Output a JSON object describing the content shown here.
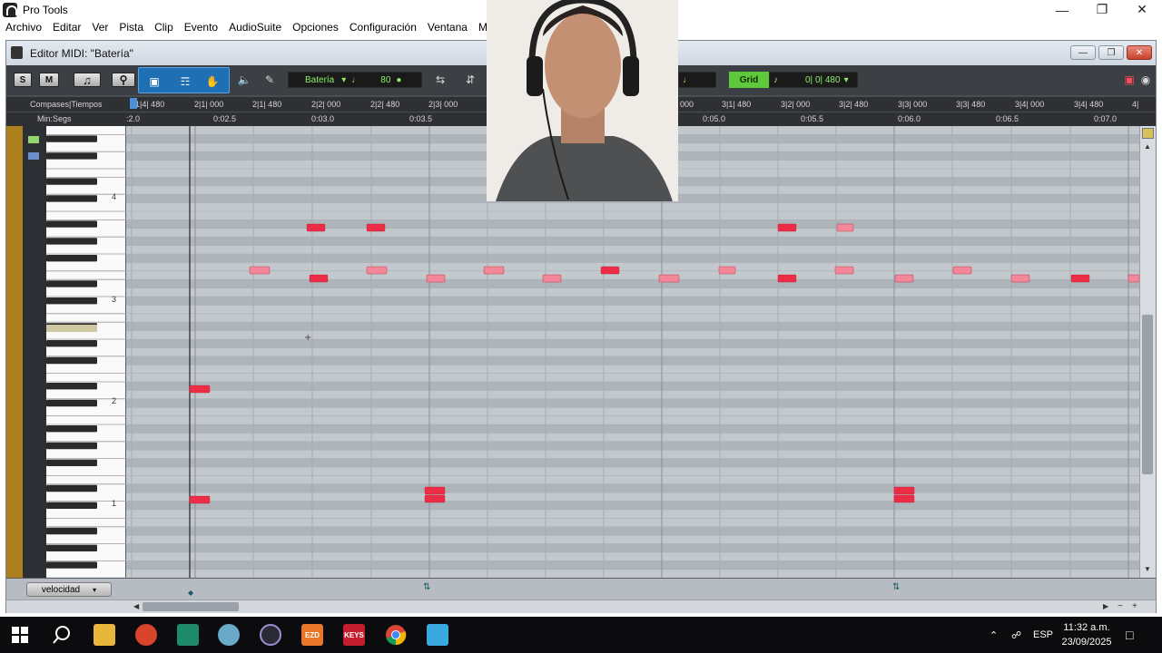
{
  "app": {
    "title": "Pro Tools"
  },
  "menubar": {
    "items": [
      "Archivo",
      "Editar",
      "Ver",
      "Pista",
      "Clip",
      "Evento",
      "AudioSuite",
      "Opciones",
      "Configuración",
      "Ventana",
      "Marke"
    ]
  },
  "editor": {
    "title": "Editor MIDI: \"Batería\"",
    "solo_label": "S",
    "mute_label": "M",
    "track_name": "Batería",
    "tempo_value": "80",
    "grid_label": "Grid",
    "grid_value": "0| 0| 480"
  },
  "ruler": {
    "header_bars": "Compases|Tiempos",
    "header_time": "Min:Segs",
    "bar_labels": [
      "1|4| 480",
      "2|1| 000",
      "2|1| 480",
      "2|2| 000",
      "2|2| 480",
      "2|3| 000",
      "000",
      "3|1| 480",
      "3|2| 000",
      "3|2| 480",
      "3|3| 000",
      "3|3| 480",
      "3|4| 000",
      "3|4| 480",
      "4|"
    ],
    "time_labels": [
      ":2.0",
      "0:02.5",
      "0:03.0",
      "0:03.5",
      "0:05.0",
      "0:05.5",
      "0:06.0",
      "0:06.5",
      "0:07.0"
    ]
  },
  "octave_labels": [
    "4",
    "3",
    "2",
    "1"
  ],
  "velocity": {
    "label": "velocidad"
  },
  "notes": {
    "colors": {
      "strong": "#ec2d45",
      "soft": "#f2889a"
    }
  },
  "taskbar": {
    "apps": [
      "windows-start",
      "search",
      "file-explorer",
      "app-red",
      "app-green",
      "app-globe",
      "pro-tools",
      "ezdrummer",
      "keys",
      "chrome",
      "app-blue"
    ],
    "ezd_label": "EZD",
    "keys_label": "KEYS",
    "language": "ESP",
    "time": "11:32 a.m.",
    "date": "23/09/2025"
  }
}
